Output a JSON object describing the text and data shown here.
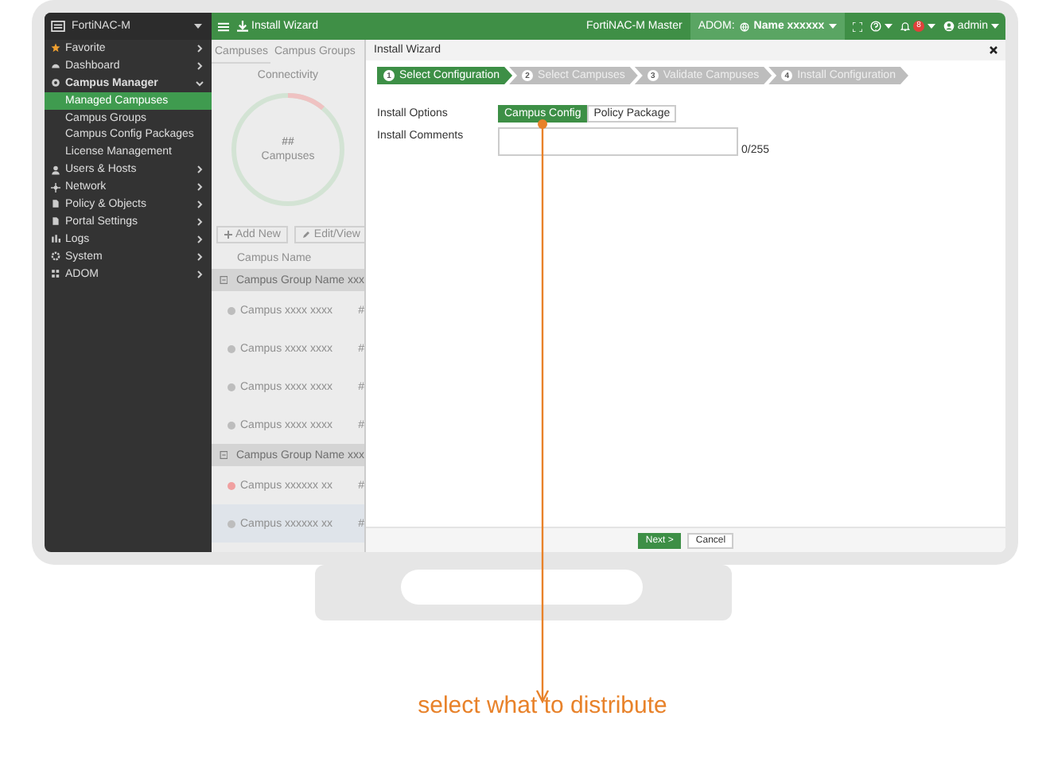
{
  "sidebar": {
    "brand": "FortiNAC-M",
    "items": [
      {
        "label": "Favorite",
        "expanded": false
      },
      {
        "label": "Dashboard",
        "expanded": false
      },
      {
        "label": "Campus Manager",
        "expanded": true,
        "children": [
          {
            "label": "Managed Campuses",
            "selected": true
          },
          {
            "label": "Campus Groups",
            "selected": false
          },
          {
            "label": "Campus Config Packages",
            "selected": false
          },
          {
            "label": "License Management",
            "selected": false
          }
        ]
      },
      {
        "label": "Users & Hosts",
        "expanded": false
      },
      {
        "label": "Network",
        "expanded": false
      },
      {
        "label": "Policy & Objects",
        "expanded": false
      },
      {
        "label": "Portal Settings",
        "expanded": false
      },
      {
        "label": "Logs",
        "expanded": false
      },
      {
        "label": "System",
        "expanded": false
      },
      {
        "label": "ADOM",
        "expanded": false
      }
    ]
  },
  "topbar": {
    "title": "Install Wizard",
    "instance": "FortiNAC-M Master",
    "adom_label": "ADOM:",
    "adom_name": "Name xxxxxx",
    "notifications": "8",
    "user": "admin"
  },
  "background_pane": {
    "tabs": [
      {
        "label": "Campuses",
        "selected": true
      },
      {
        "label": "Campus Groups",
        "selected": false
      }
    ],
    "connectivity_title": "Connectivity",
    "connectivity_value": "##",
    "connectivity_caption": "Campuses",
    "buttons": [
      "Add New",
      "Edit/View"
    ],
    "column_1": "Campus Name",
    "groups": [
      {
        "name": "Campus Group Name xxx",
        "campuses": [
          {
            "name": "Campus xxxx xxxx",
            "column_2": "#",
            "color": "#bdbdbd",
            "selected": false
          },
          {
            "name": "Campus xxxx xxxx",
            "column_2": "#",
            "color": "#bdbdbd",
            "selected": false
          },
          {
            "name": "Campus xxxx xxxx",
            "column_2": "#",
            "color": "#bdbdbd",
            "selected": false
          },
          {
            "name": "Campus xxxx xxxx",
            "column_2": "#",
            "color": "#bdbdbd",
            "selected": false
          }
        ]
      },
      {
        "name": "Campus Group Name xxx",
        "campuses": [
          {
            "name": "Campus xxxxxx xx",
            "column_2": "#",
            "color": "#f0a0a0",
            "selected": false
          },
          {
            "name": "Campus xxxxxx xx",
            "column_2": "#",
            "color": "#bdbdbd",
            "selected": true
          }
        ]
      }
    ]
  },
  "wizard": {
    "title": "Install Wizard",
    "steps": [
      {
        "number": "1",
        "label": "Select Configuration",
        "selected": true
      },
      {
        "number": "2",
        "label": "Select Campuses",
        "selected": false
      },
      {
        "number": "3",
        "label": "Validate Campuses",
        "selected": false
      },
      {
        "number": "4",
        "label": "Install Configuration",
        "selected": false
      }
    ],
    "fields": [
      {
        "kind": "options",
        "label": "Install Options",
        "options": [
          {
            "label": "Campus Config",
            "selected": true
          },
          {
            "label": "Policy Package",
            "selected": false
          }
        ]
      },
      {
        "kind": "textarea",
        "label": "Install Comments",
        "counter": "0/255"
      }
    ],
    "buttons": [
      {
        "label": "Next >",
        "kind": "primary"
      },
      {
        "label": "Cancel",
        "kind": "secondary"
      }
    ]
  },
  "callout": {
    "text": "select what to distribute"
  }
}
